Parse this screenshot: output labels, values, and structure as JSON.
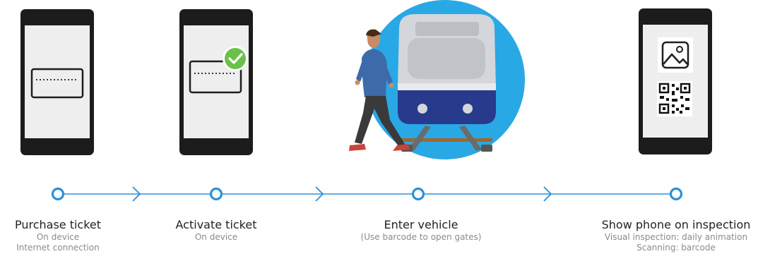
{
  "steps": [
    {
      "title": "Purchase ticket",
      "sub1": "On device",
      "sub2": "Internet connection"
    },
    {
      "title": "Activate ticket",
      "sub1": "On device",
      "sub2": ""
    },
    {
      "title": "Enter vehicle",
      "sub1": "(Use barcode to open gates)",
      "sub2": ""
    },
    {
      "title": "Show phone on inspection",
      "sub1": "Visual inspection: daily animation",
      "sub2": "Scanning: barcode"
    }
  ],
  "colors": {
    "timeline": "#2e8fd6",
    "phone_body": "#1c1c1c",
    "phone_screen": "#eeeeee",
    "check_green": "#6cc04a",
    "train_bg": "#29a8e6",
    "train_body": "#d4d6db",
    "train_band": "#283a8c",
    "person_shirt": "#3d6aa8",
    "person_pants": "#3a3a3a",
    "shoes": "#c9433a",
    "rail": "#6b6b6b",
    "tie": "#a0662a"
  }
}
